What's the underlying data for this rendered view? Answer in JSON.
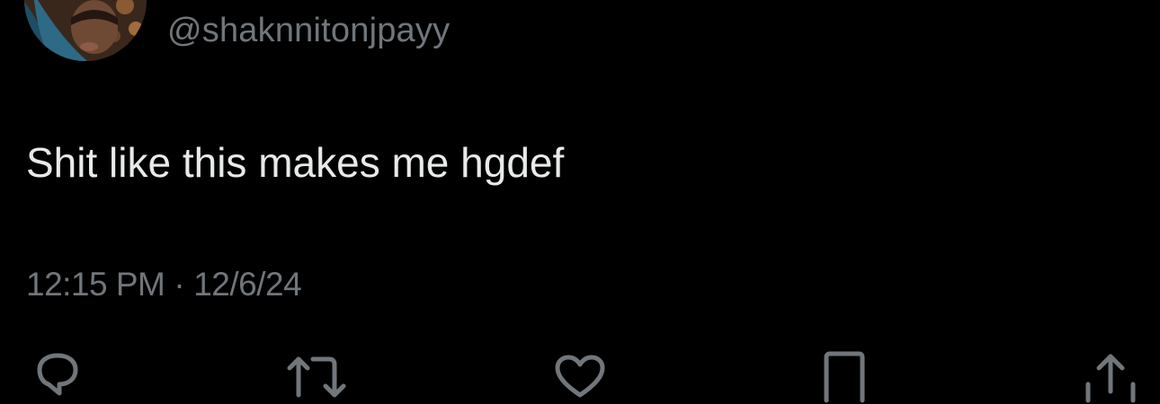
{
  "tweet": {
    "handle": "@shaknnitonjpayy",
    "text": "Shit like this makes me hgdef",
    "time": "12:15 PM",
    "separator": "·",
    "date": "12/6/24"
  },
  "actions": [
    {
      "name": "reply",
      "icon": "reply-icon"
    },
    {
      "name": "retweet",
      "icon": "retweet-icon"
    },
    {
      "name": "like",
      "icon": "heart-icon"
    },
    {
      "name": "bookmark",
      "icon": "bookmark-icon"
    },
    {
      "name": "share",
      "icon": "share-icon"
    }
  ],
  "colors": {
    "background": "#000000",
    "primary_text": "#e7e9ea",
    "secondary_text": "#71767b"
  }
}
